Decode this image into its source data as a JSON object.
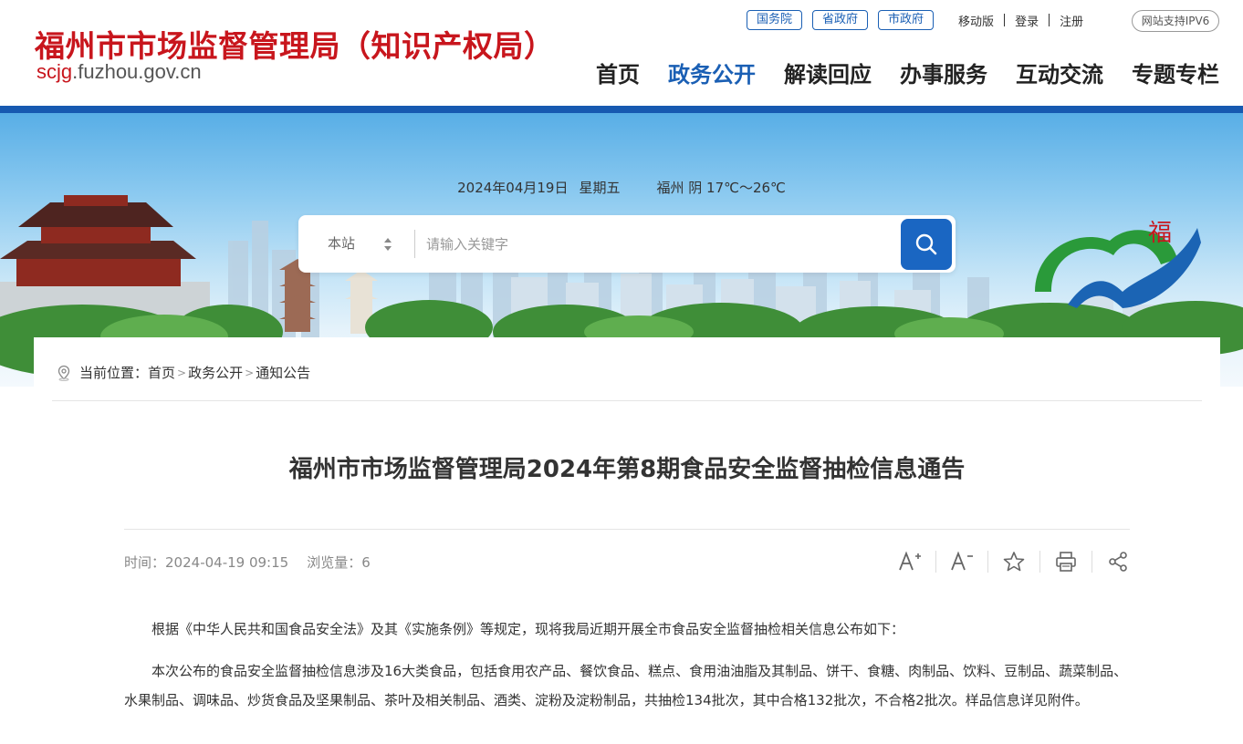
{
  "site": {
    "title": "福州市市场监督管理局（知识产权局）",
    "domain_prefix": "scjg",
    "domain_rest": ".fuzhou.gov.cn"
  },
  "toplinks": {
    "gov_links": [
      "国务院",
      "省政府",
      "市政府"
    ],
    "mobile": "移动版",
    "login": "登录",
    "register": "注册",
    "ipv6": "网站支持IPV6"
  },
  "nav": {
    "items": [
      "首页",
      "政务公开",
      "解读回应",
      "办事服务",
      "互动交流",
      "专题专栏"
    ],
    "active": "政务公开"
  },
  "banner": {
    "date": "2024年04月19日",
    "weekday": "星期五",
    "weather": "福州 阴 17℃～26℃"
  },
  "search": {
    "scope": "本站",
    "placeholder": "请输入关键字"
  },
  "breadcrumb": {
    "label": "当前位置：",
    "items": [
      "首页",
      "政务公开",
      "通知公告"
    ],
    "separator": ">"
  },
  "article": {
    "title": "福州市市场监督管理局2024年第8期食品安全监督抽检信息通告",
    "time_label": "时间：",
    "time": "2024-04-19 09:15",
    "views_label": "浏览量：",
    "views": "6",
    "tools": [
      "font-increase-icon",
      "font-decrease-icon",
      "favorite-star-icon",
      "print-icon",
      "share-icon"
    ],
    "paragraphs": [
      "根据《中华人民共和国食品安全法》及其《实施条例》等规定，现将我局近期开展全市食品安全监督抽检相关信息公布如下：",
      "本次公布的食品安全监督抽检信息涉及16大类食品，包括食用农产品、餐饮食品、糕点、食用油油脂及其制品、饼干、食糖、肉制品、饮料、豆制品、蔬菜制品、水果制品、调味品、炒货食品及坚果制品、茶叶及相关制品、酒类、淀粉及淀粉制品，共抽检134批次，其中合格132批次，不合格2批次。样品信息详见附件。"
    ]
  },
  "colors": {
    "brand_red": "#c8161d",
    "brand_blue": "#1a5fb4",
    "strip_blue": "#1759b0",
    "search_button": "#1a66c2"
  }
}
